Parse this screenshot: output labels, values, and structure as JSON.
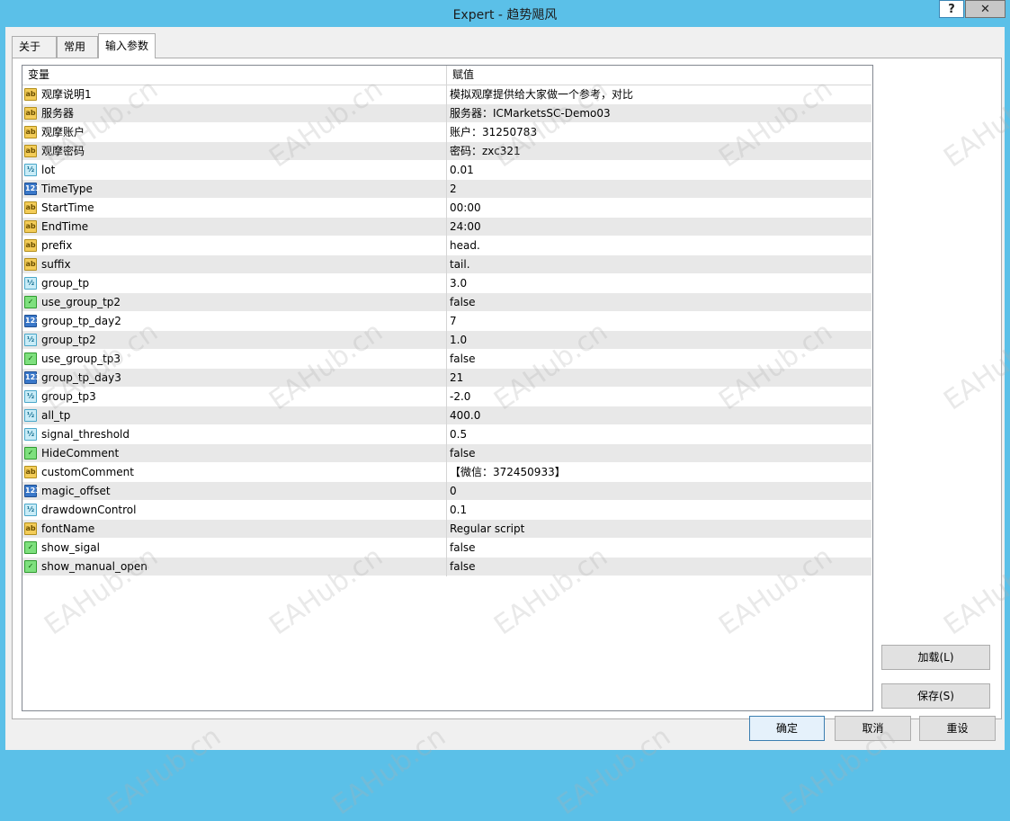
{
  "window": {
    "title": "Expert - 趋势飓风",
    "help_label": "?",
    "close_label": "✕"
  },
  "tabs": [
    {
      "label": "关于"
    },
    {
      "label": "常用"
    },
    {
      "label": "输入参数",
      "active": true
    }
  ],
  "table": {
    "headers": {
      "variable": "变量",
      "value": "赋值"
    },
    "rows": [
      {
        "type": "string",
        "icon": "ab",
        "name": "观摩说明1",
        "value": "模拟观摩提供给大家做一个参考，对比"
      },
      {
        "type": "string",
        "icon": "ab",
        "name": "服务器",
        "value": "服务器：ICMarketsSC-Demo03"
      },
      {
        "type": "string",
        "icon": "ab",
        "name": "观摩账户",
        "value": "账户：31250783"
      },
      {
        "type": "string",
        "icon": "ab",
        "name": "观摩密码",
        "value": "密码：zxc321"
      },
      {
        "type": "double",
        "icon": "½",
        "name": "lot",
        "value": "0.01"
      },
      {
        "type": "int",
        "icon": "123",
        "name": "TimeType",
        "value": "2"
      },
      {
        "type": "string",
        "icon": "ab",
        "name": "StartTime",
        "value": "00:00"
      },
      {
        "type": "string",
        "icon": "ab",
        "name": "EndTime",
        "value": "24:00"
      },
      {
        "type": "string",
        "icon": "ab",
        "name": "prefix",
        "value": "head."
      },
      {
        "type": "string",
        "icon": "ab",
        "name": "suffix",
        "value": "tail."
      },
      {
        "type": "double",
        "icon": "½",
        "name": "group_tp",
        "value": "3.0"
      },
      {
        "type": "bool",
        "icon": "✓",
        "name": "use_group_tp2",
        "value": "false"
      },
      {
        "type": "int",
        "icon": "123",
        "name": "group_tp_day2",
        "value": "7"
      },
      {
        "type": "double",
        "icon": "½",
        "name": "group_tp2",
        "value": "1.0"
      },
      {
        "type": "bool",
        "icon": "✓",
        "name": "use_group_tp3",
        "value": "false"
      },
      {
        "type": "int",
        "icon": "123",
        "name": "group_tp_day3",
        "value": "21"
      },
      {
        "type": "double",
        "icon": "½",
        "name": "group_tp3",
        "value": "-2.0"
      },
      {
        "type": "double",
        "icon": "½",
        "name": "all_tp",
        "value": "400.0"
      },
      {
        "type": "double",
        "icon": "½",
        "name": "signal_threshold",
        "value": "0.5"
      },
      {
        "type": "bool",
        "icon": "✓",
        "name": "HideComment",
        "value": "false"
      },
      {
        "type": "string",
        "icon": "ab",
        "name": "customComment",
        "value": "【微信：372450933】"
      },
      {
        "type": "int",
        "icon": "123",
        "name": "magic_offset",
        "value": "0"
      },
      {
        "type": "double",
        "icon": "½",
        "name": "drawdownControl",
        "value": "0.1"
      },
      {
        "type": "string",
        "icon": "ab",
        "name": "fontName",
        "value": "Regular script"
      },
      {
        "type": "bool",
        "icon": "✓",
        "name": "show_sigal",
        "value": "false"
      },
      {
        "type": "bool",
        "icon": "✓",
        "name": "show_manual_open",
        "value": "false"
      }
    ]
  },
  "side_buttons": {
    "load": "加载(L)",
    "save": "保存(S)"
  },
  "footer_buttons": {
    "ok": "确定",
    "cancel": "取消",
    "reset": "重设"
  },
  "watermark": "EAHub.cn",
  "colors": {
    "titlebar": "#5bc0e8",
    "stripe": "#e8e8e8"
  }
}
